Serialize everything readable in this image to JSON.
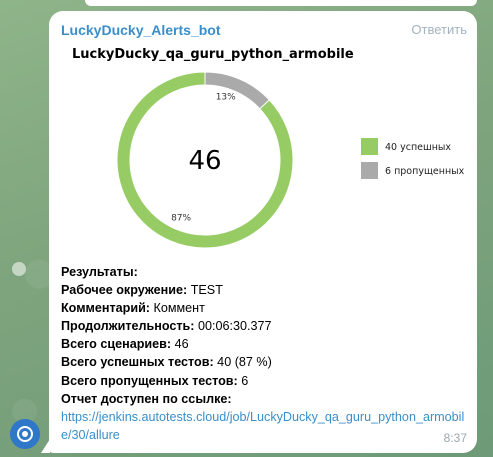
{
  "message": {
    "sender": "LuckyDucky_Alerts_bot",
    "reply_label": "Ответить",
    "time": "8:37"
  },
  "chart_data": {
    "type": "pie",
    "title": "LuckyDucky_qa_guru_python_armobile",
    "center_label": "46",
    "slices": [
      {
        "label": "40 успешных",
        "value": 40,
        "percent_label": "87%",
        "color": "#97cc64"
      },
      {
        "label": "6 пропущенных",
        "value": 6,
        "percent_label": "13%",
        "color": "#aaaaaa"
      }
    ],
    "legend": "right"
  },
  "report": {
    "results_label": "Результаты:",
    "env_label": "Рабочее окружение:",
    "env_value": " TEST",
    "comment_label": "Комментарий:",
    "comment_value": " Коммент",
    "duration_label": "Продолжительность:",
    "duration_value": " 00:06:30.377",
    "scenarios_label": "Всего сценариев:",
    "scenarios_value": " 46",
    "passed_label": "Всего успешных тестов:",
    "passed_value": " 40 (87 %)",
    "skipped_label": "Всего пропущенных тестов:",
    "skipped_value": " 6",
    "link_label": "Отчет доступен по ссылке:",
    "link_url": "https://jenkins.autotests.cloud/job/LuckyDucky_qa_guru_python_armobile/30/allure"
  },
  "icons": {
    "avatar": "bot-avatar-icon",
    "badge": "sticker-icon"
  }
}
